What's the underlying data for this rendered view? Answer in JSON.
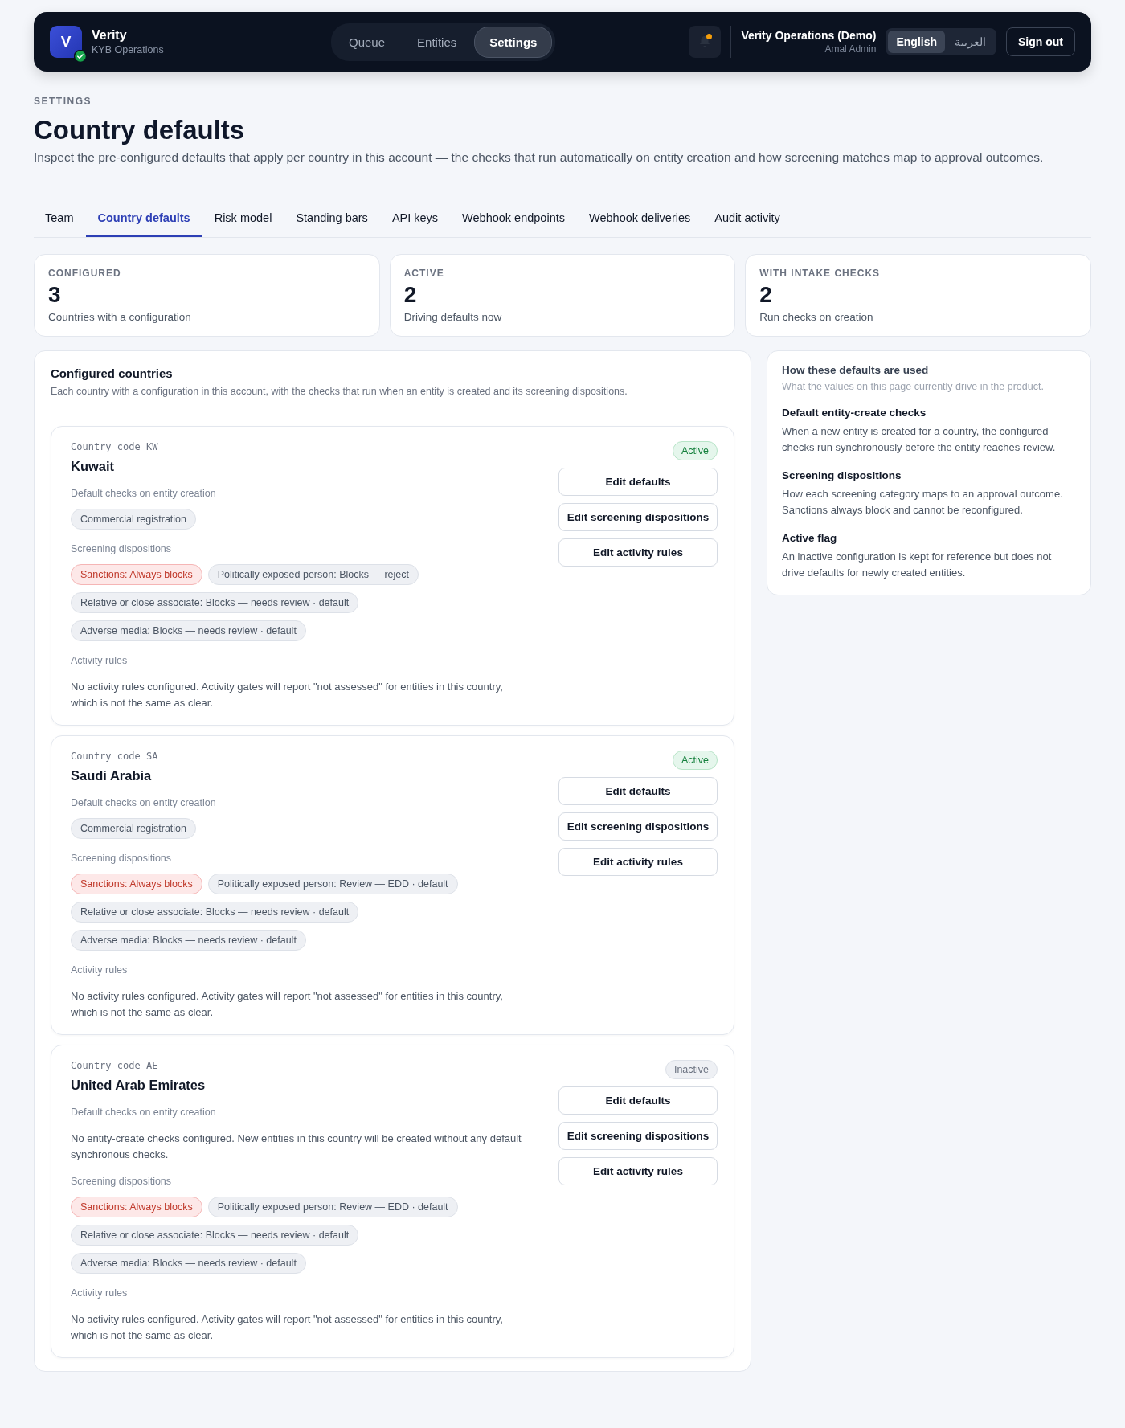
{
  "header": {
    "logo_letter": "V",
    "verified": true,
    "brand": "Verity",
    "subtitle": "KYB Operations",
    "nav": [
      {
        "label": "Queue",
        "selected": false
      },
      {
        "label": "Entities",
        "selected": false
      },
      {
        "label": "Settings",
        "selected": true
      }
    ],
    "notification_unread": true,
    "account_name": "Verity Operations (Demo)",
    "user_name": "Amal Admin",
    "languages": [
      {
        "label": "English",
        "selected": true
      },
      {
        "label": "العربية",
        "selected": false
      }
    ],
    "sign_out": "Sign out"
  },
  "page": {
    "eyebrow": "SETTINGS",
    "title": "Country defaults",
    "description": "Inspect the pre-configured defaults that apply per country in this account — the checks that run automatically on entity creation and how screening matches map to approval outcomes."
  },
  "tabs": [
    {
      "label": "Team",
      "selected": false
    },
    {
      "label": "Country defaults",
      "selected": true
    },
    {
      "label": "Risk model",
      "selected": false
    },
    {
      "label": "Standing bars",
      "selected": false
    },
    {
      "label": "API keys",
      "selected": false
    },
    {
      "label": "Webhook endpoints",
      "selected": false
    },
    {
      "label": "Webhook deliveries",
      "selected": false
    },
    {
      "label": "Audit activity",
      "selected": false
    }
  ],
  "stats": [
    {
      "label": "CONFIGURED",
      "value": "3",
      "caption": "Countries with a configuration"
    },
    {
      "label": "ACTIVE",
      "value": "2",
      "caption": "Driving defaults now"
    },
    {
      "label": "WITH INTAKE CHECKS",
      "value": "2",
      "caption": "Run checks on creation"
    }
  ],
  "countries_panel": {
    "title": "Configured countries",
    "description": "Each country with a configuration in this account, with the checks that run when an entity is created and its screening dispositions.",
    "countries": [
      {
        "code_label": "Country code KW",
        "name": "Kuwait",
        "active": true,
        "status": "Active",
        "checks_label": "Default checks on entity creation",
        "checks": [
          "Commercial registration"
        ],
        "dispositions_label": "Screening dispositions",
        "dispositions": [
          {
            "text": "Sanctions: Always blocks",
            "kind": "fixed"
          },
          {
            "text": "Politically exposed person: Blocks — reject",
            "kind": "normal"
          },
          {
            "text": "Relative or close associate: Blocks — needs review · default",
            "kind": "normal"
          },
          {
            "text": "Adverse media: Blocks — needs review · default",
            "kind": "normal"
          }
        ],
        "rules_label": "Activity rules",
        "rules_text": "No activity rules configured. Activity gates will report \"not assessed\" for entities in this country, which is not the same as clear.",
        "actions": [
          "Edit defaults",
          "Edit screening dispositions",
          "Edit activity rules"
        ]
      },
      {
        "code_label": "Country code SA",
        "name": "Saudi Arabia",
        "active": true,
        "status": "Active",
        "checks_label": "Default checks on entity creation",
        "checks": [
          "Commercial registration"
        ],
        "dispositions_label": "Screening dispositions",
        "dispositions": [
          {
            "text": "Sanctions: Always blocks",
            "kind": "fixed"
          },
          {
            "text": "Politically exposed person: Review — EDD · default",
            "kind": "normal"
          },
          {
            "text": "Relative or close associate: Blocks — needs review · default",
            "kind": "normal"
          },
          {
            "text": "Adverse media: Blocks — needs review · default",
            "kind": "normal"
          }
        ],
        "rules_label": "Activity rules",
        "rules_text": "No activity rules configured. Activity gates will report \"not assessed\" for entities in this country, which is not the same as clear.",
        "actions": [
          "Edit defaults",
          "Edit screening dispositions",
          "Edit activity rules"
        ]
      },
      {
        "code_label": "Country code AE",
        "name": "United Arab Emirates",
        "active": false,
        "status": "Inactive",
        "checks_label": "Default checks on entity creation",
        "checks_empty": "No entity-create checks configured. New entities in this country will be created without any default synchronous checks.",
        "dispositions_label": "Screening dispositions",
        "dispositions": [
          {
            "text": "Sanctions: Always blocks",
            "kind": "fixed"
          },
          {
            "text": "Politically exposed person: Review — EDD · default",
            "kind": "normal"
          },
          {
            "text": "Relative or close associate: Blocks — needs review · default",
            "kind": "normal"
          },
          {
            "text": "Adverse media: Blocks — needs review · default",
            "kind": "normal"
          }
        ],
        "rules_label": "Activity rules",
        "rules_text": "No activity rules configured. Activity gates will report \"not assessed\" for entities in this country, which is not the same as clear.",
        "actions": [
          "Edit defaults",
          "Edit screening dispositions",
          "Edit activity rules"
        ]
      }
    ]
  },
  "help": {
    "title": "How these defaults are used",
    "subtitle": "What the values on this page currently drive in the product.",
    "sections": [
      {
        "title": "Default entity-create checks",
        "text": "When a new entity is created for a country, the configured checks run synchronously before the entity reaches review."
      },
      {
        "title": "Screening dispositions",
        "text": "How each screening category maps to an approval outcome. Sanctions always block and cannot be reconfigured."
      },
      {
        "title": "Active flag",
        "text": "An inactive configuration is kept for reference but does not drive defaults for newly created entities."
      }
    ]
  }
}
